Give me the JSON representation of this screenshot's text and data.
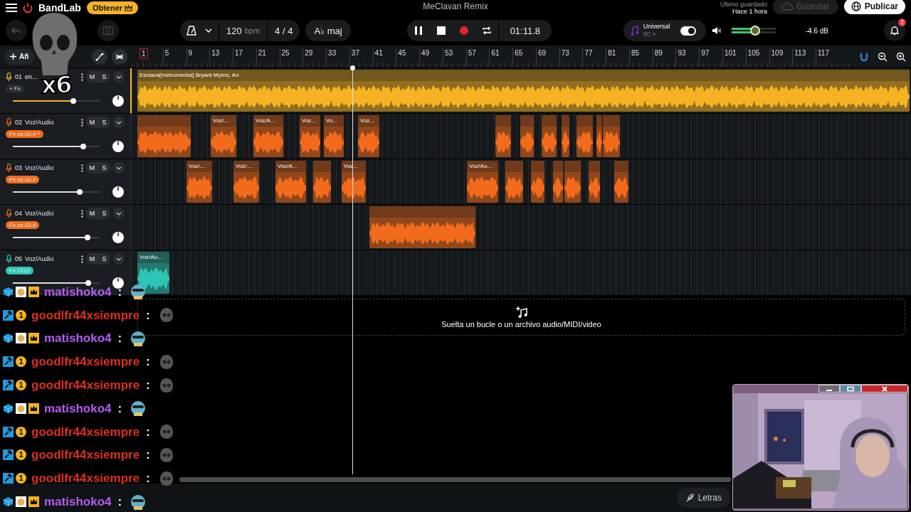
{
  "app_bar": {
    "brand": "BandLab",
    "upgrade_button": "Obtener",
    "project_title": "MeClavan Remix",
    "save_status": "Último guardado",
    "save_time": "Hace 1 hora",
    "save_button": {
      "label": "Guardar",
      "disabled": true
    },
    "publish_button": "Publicar"
  },
  "toolbar": {
    "tempo": "120",
    "tempo_unit": "bpm",
    "time_signature": "4 / 4",
    "key": "A♭ maj",
    "transport": [
      {
        "kind": "pause"
      },
      {
        "kind": "stop"
      },
      {
        "kind": "record"
      },
      {
        "kind": "loop"
      }
    ],
    "time": "01:11.8",
    "preset": {
      "name": "Universal",
      "value": "80 >",
      "on": true
    },
    "master_volume": {
      "level": 0.53
    },
    "master_reading": "-4.6 dB",
    "notifications": "2"
  },
  "track_panel": {
    "add_label": "Añ"
  },
  "ruler": {
    "bars": [
      "1",
      "5",
      "9",
      "13",
      "17",
      "21",
      "25",
      "29",
      "33",
      "37",
      "41",
      "45",
      "49",
      "53",
      "57",
      "61",
      "65",
      "69",
      "73",
      "77",
      "81",
      "85",
      "89",
      "93",
      "97",
      "101",
      "105",
      "109",
      "113",
      "117"
    ]
  },
  "tracks": [
    {
      "number": "01",
      "name": "en...",
      "mute": "M",
      "solo": "S",
      "fx": {
        "label": "+ Fx",
        "active": false
      },
      "selected": true,
      "color": "#f5b323",
      "level": 0.7,
      "clips": [
        {
          "kind": "audio",
          "label": "Esclava[Instrumental] Bryant Myers, An"
        }
      ]
    },
    {
      "number": "02",
      "name": "Voz/Audio",
      "mute": "M",
      "solo": "S",
      "fx": {
        "label": "Fx zo-GL4 *",
        "active": true
      },
      "selected": false,
      "color": "#f26b1d",
      "level": 0.81,
      "clips": [
        {
          "kind": "audio"
        },
        {
          "kind": "audio",
          "label": "Voz/..."
        },
        {
          "kind": "audio",
          "label": "Voz/A..."
        },
        {
          "kind": "audio",
          "label": "Voz..."
        },
        {
          "kind": "audio",
          "label": "Vo..."
        },
        {
          "kind": "audio",
          "label": "Voz..."
        },
        {
          "kind": "audio"
        },
        {
          "kind": "audio"
        },
        {
          "kind": "audio"
        },
        {
          "kind": "audio"
        },
        {
          "kind": "audio"
        },
        {
          "kind": "audio"
        },
        {
          "kind": "audio"
        }
      ]
    },
    {
      "number": "03",
      "name": "Voz/Audio",
      "mute": "M",
      "solo": "S",
      "fx": {
        "label": "Fx zo-GL4",
        "active": true
      },
      "selected": false,
      "color": "#f26b1d",
      "level": 0.77,
      "clips": [
        {
          "kind": "audio",
          "label": "Voz/..."
        },
        {
          "kind": "audio",
          "label": "Voz/..."
        },
        {
          "kind": "audio",
          "label": "Voz/A..."
        },
        {
          "kind": "audio"
        },
        {
          "kind": "audio",
          "label": "Voz..."
        },
        {
          "kind": "audio",
          "label": "Voz/Au..."
        },
        {
          "kind": "audio"
        },
        {
          "kind": "audio"
        },
        {
          "kind": "audio"
        },
        {
          "kind": "audio"
        },
        {
          "kind": "audio"
        },
        {
          "kind": "audio"
        }
      ]
    },
    {
      "number": "04",
      "name": "Voz/Audio",
      "mute": "M",
      "solo": "S",
      "fx": {
        "label": "Fx zo-GL4",
        "active": true
      },
      "selected": false,
      "color": "#f26b1d",
      "level": 0.86,
      "clips": [
        {
          "kind": "audio"
        }
      ]
    },
    {
      "number": "05",
      "name": "Voz/Audio",
      "mute": "M",
      "solo": "S",
      "fx": {
        "label": "Fx 1212",
        "active": true
      },
      "selected": false,
      "color": "#2ec4b6",
      "level": 0.87,
      "clips": [
        {
          "kind": "audio",
          "label": "Voz/Au..."
        }
      ]
    }
  ],
  "drop_zone": {
    "text": "Suelta un bucle o un archivo audio/MIDI/video"
  },
  "lyrics_button": "Letras",
  "overlay": {
    "combo": "x6"
  },
  "chat": [
    {
      "kind": "sub",
      "user": "matishoko4",
      "color": "#b45cf2",
      "sep": ":"
    },
    {
      "kind": "mod",
      "badge": "1",
      "user": "goodlfr44xsiempre",
      "color": "#e0301e",
      "sep": ":"
    },
    {
      "kind": "sub",
      "user": "matishoko4",
      "color": "#b45cf2",
      "sep": ":"
    },
    {
      "kind": "mod",
      "badge": "1",
      "user": "goodlfr44xsiempre",
      "color": "#e0301e",
      "sep": ":"
    },
    {
      "kind": "mod",
      "badge": "1",
      "user": "goodlfr44xsiempre",
      "color": "#e0301e",
      "sep": ":"
    },
    {
      "kind": "sub",
      "user": "matishoko4",
      "color": "#b45cf2",
      "sep": ":"
    },
    {
      "kind": "mod",
      "badge": "1",
      "user": "goodlfr44xsiempre",
      "color": "#e0301e",
      "sep": ":"
    },
    {
      "kind": "mod",
      "badge": "1",
      "user": "goodlfr44xsiempre",
      "color": "#e0301e",
      "sep": ":"
    },
    {
      "kind": "mod",
      "badge": "1",
      "user": "goodlfr44xsiempre",
      "color": "#e0301e",
      "sep": ":"
    },
    {
      "kind": "sub",
      "user": "matishoko4",
      "color": "#b45cf2",
      "sep": ":"
    }
  ]
}
